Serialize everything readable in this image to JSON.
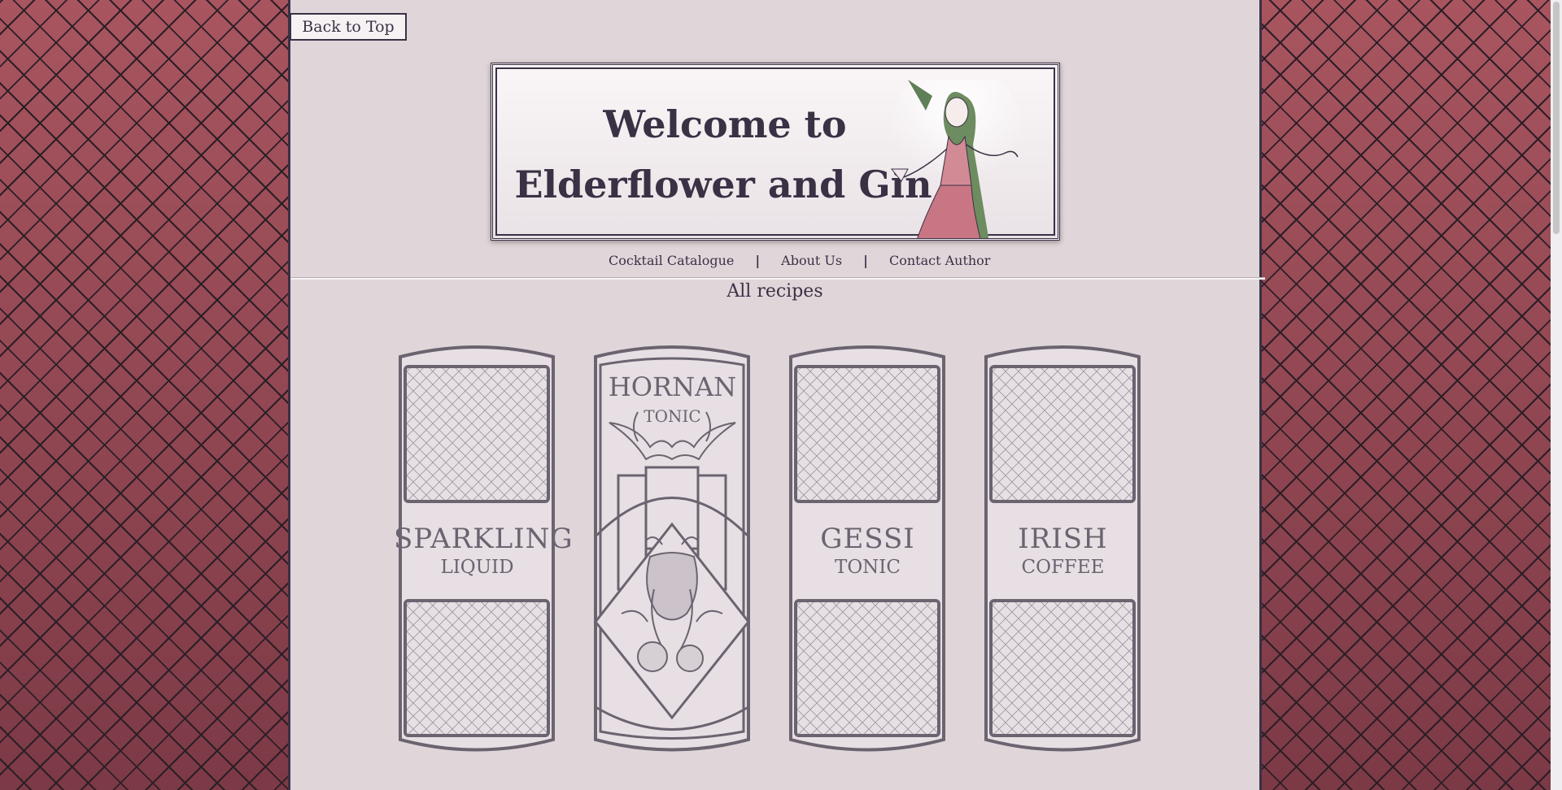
{
  "back_to_top": "Back to Top",
  "banner": {
    "line1": "Welcome to",
    "line2": "Elderflower and Gin"
  },
  "nav": [
    {
      "label": "Cocktail Catalogue"
    },
    {
      "label": "About Us"
    },
    {
      "label": "Contact Author"
    }
  ],
  "section_title": "All recipes",
  "cards": [
    {
      "main": "SPARKLING",
      "sub": "LIQUID"
    },
    {
      "main": "HORNAN",
      "sub": "TONIC"
    },
    {
      "main": "GESSI",
      "sub": "TONIC"
    },
    {
      "main": "IRISH",
      "sub": "COFFEE"
    }
  ],
  "colors": {
    "accent": "#3a3145",
    "background": "#e0d6da",
    "pattern": "#9a4a57",
    "card_stroke": "#6b6470"
  }
}
